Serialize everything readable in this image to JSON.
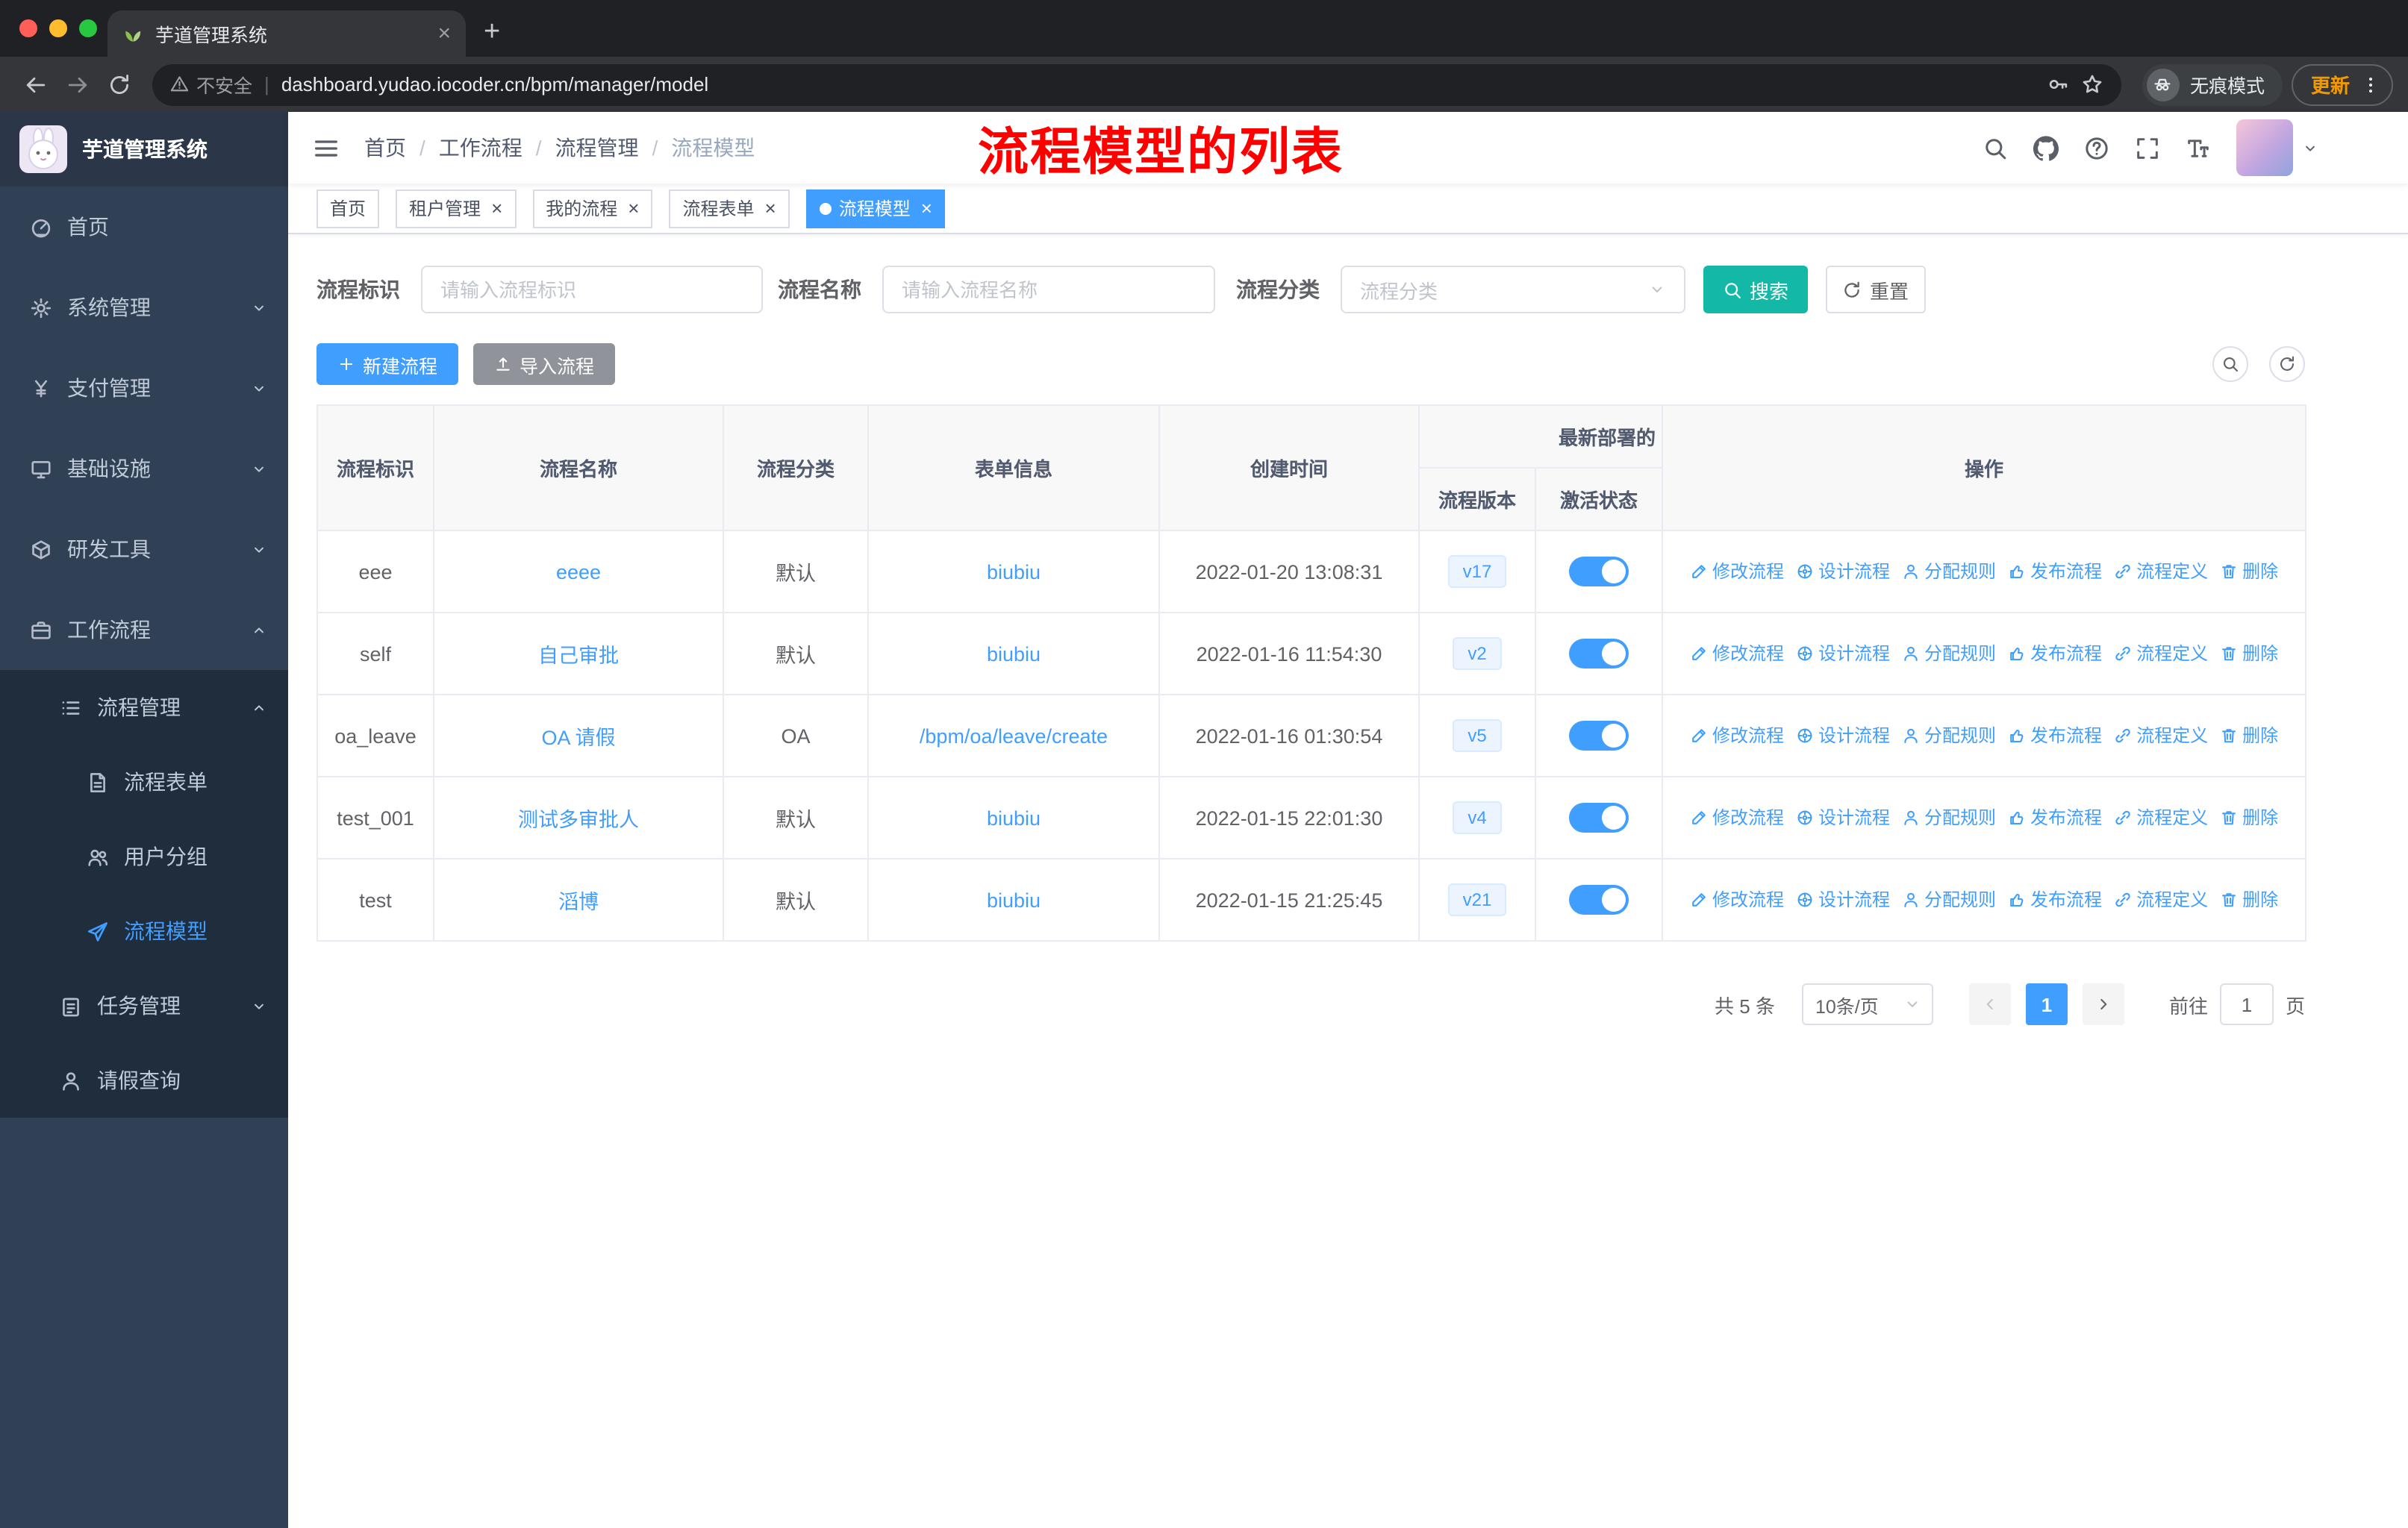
{
  "browser": {
    "tab_title": "芋道管理系统",
    "address": {
      "security_label": "不安全",
      "url": "dashboard.yudao.iocoder.cn/bpm/manager/model"
    },
    "incognito_label": "无痕模式",
    "update_label": "更新"
  },
  "app": {
    "logo_title": "芋道管理系统",
    "breadcrumb": [
      "首页",
      "工作流程",
      "流程管理",
      "流程模型"
    ],
    "annotation": "流程模型的列表"
  },
  "sidebar": {
    "menu": [
      {
        "key": "home",
        "label": "首页",
        "icon": "dashboard-icon",
        "depth": 0
      },
      {
        "key": "system",
        "label": "系统管理",
        "icon": "gear-icon",
        "depth": 0,
        "chevron": "down"
      },
      {
        "key": "payment",
        "label": "支付管理",
        "icon": "payment-icon",
        "depth": 0,
        "chevron": "down"
      },
      {
        "key": "infrastructure",
        "label": "基础设施",
        "icon": "infrastructure-icon",
        "depth": 0,
        "chevron": "down"
      },
      {
        "key": "devtools",
        "label": "研发工具",
        "icon": "devtools-icon",
        "depth": 0,
        "chevron": "down"
      },
      {
        "key": "workflow",
        "label": "工作流程",
        "icon": "workflow-icon",
        "depth": 0,
        "chevron": "up"
      },
      {
        "key": "process-manage",
        "label": "流程管理",
        "icon": "process-list-icon",
        "depth": 1,
        "chevron": "up",
        "sub": true
      },
      {
        "key": "process-form",
        "label": "流程表单",
        "icon": "form-icon",
        "depth": 2,
        "sub": true
      },
      {
        "key": "user-group",
        "label": "用户分组",
        "icon": "user-group-icon",
        "depth": 2,
        "sub": true
      },
      {
        "key": "process-model",
        "label": "流程模型",
        "icon": "paper-plane-icon",
        "depth": 2,
        "sub": true,
        "active": true
      },
      {
        "key": "task-manage",
        "label": "任务管理",
        "icon": "task-icon",
        "depth": 1,
        "chevron": "down",
        "sub": true
      },
      {
        "key": "leave-query",
        "label": "请假查询",
        "icon": "user-icon",
        "depth": 1,
        "sub": true
      }
    ]
  },
  "tags": [
    {
      "key": "home",
      "label": "首页",
      "closable": false,
      "active": false
    },
    {
      "key": "tenant-manage",
      "label": "租户管理",
      "closable": true,
      "active": false
    },
    {
      "key": "my-process",
      "label": "我的流程",
      "closable": true,
      "active": false
    },
    {
      "key": "process-form",
      "label": "流程表单",
      "closable": true,
      "active": false
    },
    {
      "key": "process-model",
      "label": "流程模型",
      "closable": true,
      "active": true
    }
  ],
  "filters": {
    "fields": [
      {
        "label": "流程标识",
        "placeholder": "请输入流程标识"
      },
      {
        "label": "流程名称",
        "placeholder": "请输入流程名称"
      },
      {
        "label": "流程分类",
        "placeholder": "流程分类"
      }
    ],
    "search_label": "搜索",
    "reset_label": "重置"
  },
  "toolbar": {
    "create_label": "新建流程",
    "import_label": "导入流程"
  },
  "table": {
    "group_header": "最新部署的",
    "columns": [
      "流程标识",
      "流程名称",
      "流程分类",
      "表单信息",
      "创建时间",
      "流程版本",
      "激活状态",
      "操作"
    ],
    "actions": [
      {
        "key": "modify",
        "label": "修改流程",
        "icon": "edit-icon"
      },
      {
        "key": "design",
        "label": "设计流程",
        "icon": "design-icon"
      },
      {
        "key": "assign-rule",
        "label": "分配规则",
        "icon": "assign-icon"
      },
      {
        "key": "publish",
        "label": "发布流程",
        "icon": "publish-icon"
      },
      {
        "key": "definition",
        "label": "流程定义",
        "icon": "definition-icon"
      },
      {
        "key": "delete",
        "label": "删除",
        "icon": "delete-icon"
      }
    ],
    "rows": [
      {
        "key": "eee",
        "name": "eeee",
        "category": "默认",
        "form": "biubiu",
        "created": "2022-01-20 13:08:31",
        "version": "v17",
        "active": true
      },
      {
        "key": "self",
        "name": "自己审批",
        "category": "默认",
        "form": "biubiu",
        "created": "2022-01-16 11:54:30",
        "version": "v2",
        "active": true
      },
      {
        "key": "oa_leave",
        "name": "OA 请假",
        "category": "OA",
        "form": "/bpm/oa/leave/create",
        "created": "2022-01-16 01:30:54",
        "version": "v5",
        "active": true
      },
      {
        "key": "test_001",
        "name": "测试多审批人",
        "category": "默认",
        "form": "biubiu",
        "created": "2022-01-15 22:01:30",
        "version": "v4",
        "active": true
      },
      {
        "key": "test",
        "name": "滔博",
        "category": "默认",
        "form": "biubiu",
        "created": "2022-01-15 21:25:45",
        "version": "v21",
        "active": true
      }
    ]
  },
  "pagination": {
    "total": "共 5 条",
    "page_size": "10条/页",
    "current_page": "1",
    "goto_prefix": "前往",
    "goto_value": "1",
    "goto_suffix": "页"
  },
  "colors": {
    "primary": "#409EFF",
    "search_button": "#14B8A6",
    "annotation": "#FF0000",
    "sidebar_bg": "#304156",
    "submenu_bg": "#1F2D3D",
    "tag_active": "#409EFF"
  }
}
